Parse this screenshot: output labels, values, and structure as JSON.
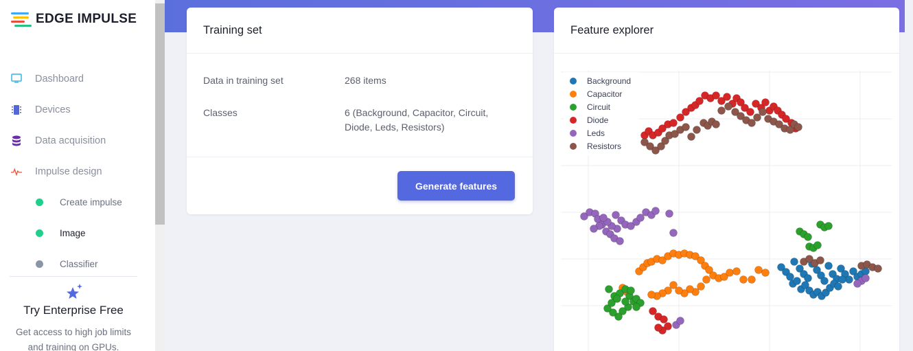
{
  "app": {
    "logo_text": "EDGE IMPULSE"
  },
  "sidebar": {
    "items": [
      {
        "label": "Dashboard",
        "icon": "monitor-icon",
        "color": "#35b7e0"
      },
      {
        "label": "Devices",
        "icon": "chip-icon",
        "color": "#5566d6"
      },
      {
        "label": "Data acquisition",
        "icon": "database-icon",
        "color": "#6a2fa8"
      },
      {
        "label": "Impulse design",
        "icon": "pulse-icon",
        "color": "#e8553d"
      }
    ],
    "subitems": [
      {
        "label": "Create impulse",
        "dot_color": "#1fcf8b"
      },
      {
        "label": "Image",
        "dot_color": "#1fcf8b"
      },
      {
        "label": "Classifier",
        "dot_color": "#8b95a8"
      }
    ],
    "promo": {
      "title": "Try Enterprise Free",
      "text": "Get access to high job limits and training on GPUs."
    }
  },
  "training_set": {
    "title": "Training set",
    "rows": [
      {
        "label": "Data in training set",
        "value": "268 items"
      },
      {
        "label": "Classes",
        "value": "6 (Background, Capacitor, Circuit, Diode, Leds, Resistors)"
      }
    ],
    "button_label": "Generate features"
  },
  "feature_explorer": {
    "title": "Feature explorer",
    "chart_data": {
      "type": "scatter",
      "grid": true,
      "legend_position": "top-left",
      "series": [
        {
          "name": "Background",
          "color": "#1f77b4",
          "points": [
            [
              323,
              378
            ],
            [
              330,
              385
            ],
            [
              336,
              392
            ],
            [
              342,
              370
            ],
            [
              350,
              380
            ],
            [
              356,
              388
            ],
            [
              362,
              394
            ],
            [
              368,
              373
            ],
            [
              375,
              382
            ],
            [
              381,
              390
            ],
            [
              386,
              398
            ],
            [
              392,
              376
            ],
            [
              398,
              388
            ],
            [
              404,
              395
            ],
            [
              410,
              380
            ],
            [
              416,
              388
            ],
            [
              422,
              396
            ],
            [
              428,
              384
            ],
            [
              434,
              392
            ],
            [
              440,
              388
            ],
            [
              446,
              384
            ],
            [
              340,
              402
            ],
            [
              346,
              398
            ],
            [
              352,
              410
            ],
            [
              358,
              404
            ],
            [
              364,
              412
            ],
            [
              370,
              418
            ],
            [
              376,
              414
            ],
            [
              382,
              420
            ],
            [
              388,
              415
            ],
            [
              394,
              408
            ],
            [
              400,
              402
            ],
            [
              406,
              406
            ],
            [
              412,
              396
            ]
          ]
        },
        {
          "name": "Capacitor",
          "color": "#ff7f0e",
          "points": [
            [
              116,
              384
            ],
            [
              122,
              378
            ],
            [
              128,
              372
            ],
            [
              134,
              370
            ],
            [
              142,
              366
            ],
            [
              150,
              368
            ],
            [
              158,
              362
            ],
            [
              166,
              358
            ],
            [
              174,
              360
            ],
            [
              182,
              358
            ],
            [
              190,
              360
            ],
            [
              198,
              362
            ],
            [
              206,
              368
            ],
            [
              212,
              376
            ],
            [
              218,
              382
            ],
            [
              224,
              390
            ],
            [
              232,
              394
            ],
            [
              240,
              392
            ],
            [
              248,
              386
            ],
            [
              258,
              384
            ],
            [
              268,
              396
            ],
            [
              280,
              396
            ],
            [
              290,
              382
            ],
            [
              300,
              386
            ],
            [
              214,
              396
            ],
            [
              206,
              406
            ],
            [
              198,
              414
            ],
            [
              190,
              410
            ],
            [
              182,
              416
            ],
            [
              174,
              412
            ],
            [
              166,
              404
            ],
            [
              158,
              412
            ],
            [
              150,
              416
            ],
            [
              142,
              420
            ],
            [
              134,
              418
            ],
            [
              92,
              408
            ],
            [
              98,
              414
            ]
          ]
        },
        {
          "name": "Circuit",
          "color": "#2ca02c",
          "points": [
            [
              72,
              410
            ],
            [
              80,
              420
            ],
            [
              88,
              416
            ],
            [
              96,
              410
            ],
            [
              102,
              420
            ],
            [
              108,
              428
            ],
            [
              100,
              436
            ],
            [
              92,
              442
            ],
            [
              86,
              450
            ],
            [
              78,
              444
            ],
            [
              70,
              438
            ],
            [
              76,
              430
            ],
            [
              84,
              424
            ],
            [
              96,
              428
            ],
            [
              104,
              412
            ],
            [
              112,
              424
            ],
            [
              118,
              430
            ],
            [
              112,
              436
            ],
            [
              350,
              326
            ],
            [
              356,
              330
            ],
            [
              362,
              334
            ],
            [
              380,
              316
            ],
            [
              386,
              320
            ],
            [
              392,
              318
            ],
            [
              364,
              348
            ],
            [
              370,
              350
            ],
            [
              376,
              346
            ]
          ]
        },
        {
          "name": "Diode",
          "color": "#d62728",
          "points": [
            [
              124,
              186
            ],
            [
              130,
              180
            ],
            [
              136,
              186
            ],
            [
              144,
              182
            ],
            [
              150,
              176
            ],
            [
              158,
              170
            ],
            [
              166,
              168
            ],
            [
              176,
              160
            ],
            [
              184,
              152
            ],
            [
              192,
              146
            ],
            [
              198,
              142
            ],
            [
              204,
              136
            ],
            [
              212,
              128
            ],
            [
              220,
              132
            ],
            [
              228,
              128
            ],
            [
              236,
              136
            ],
            [
              244,
              130
            ],
            [
              252,
              140
            ],
            [
              258,
              132
            ],
            [
              264,
              138
            ],
            [
              270,
              146
            ],
            [
              278,
              152
            ],
            [
              286,
              140
            ],
            [
              294,
              146
            ],
            [
              300,
              138
            ],
            [
              306,
              150
            ],
            [
              312,
              144
            ],
            [
              318,
              150
            ],
            [
              324,
              156
            ],
            [
              330,
              162
            ],
            [
              338,
              168
            ],
            [
              344,
              176
            ],
            [
              136,
              442
            ],
            [
              144,
              450
            ],
            [
              152,
              454
            ],
            [
              158,
              464
            ],
            [
              150,
              470
            ],
            [
              144,
              466
            ]
          ]
        },
        {
          "name": "Leds",
          "color": "#9467bd",
          "points": [
            [
              36,
              304
            ],
            [
              44,
              298
            ],
            [
              52,
              300
            ],
            [
              56,
              308
            ],
            [
              62,
              316
            ],
            [
              68,
              326
            ],
            [
              74,
              330
            ],
            [
              80,
              336
            ],
            [
              88,
              340
            ],
            [
              84,
              322
            ],
            [
              76,
              318
            ],
            [
              70,
              312
            ],
            [
              64,
              306
            ],
            [
              58,
              318
            ],
            [
              50,
              322
            ],
            [
              82,
              302
            ],
            [
              90,
              310
            ],
            [
              96,
              316
            ],
            [
              104,
              318
            ],
            [
              112,
              312
            ],
            [
              118,
              306
            ],
            [
              126,
              298
            ],
            [
              134,
              302
            ],
            [
              140,
              296
            ],
            [
              160,
              300
            ],
            [
              166,
              328
            ],
            [
              170,
              462
            ],
            [
              176,
              456
            ],
            [
              440,
              398
            ],
            [
              446,
              394
            ],
            [
              434,
              402
            ]
          ]
        },
        {
          "name": "Resistors",
          "color": "#8c564b",
          "points": [
            [
              124,
              196
            ],
            [
              132,
              202
            ],
            [
              140,
              208
            ],
            [
              148,
              202
            ],
            [
              154,
              194
            ],
            [
              160,
              186
            ],
            [
              168,
              184
            ],
            [
              176,
              178
            ],
            [
              184,
              174
            ],
            [
              192,
              188
            ],
            [
              200,
              178
            ],
            [
              210,
              168
            ],
            [
              216,
              172
            ],
            [
              222,
              166
            ],
            [
              228,
              170
            ],
            [
              236,
              150
            ],
            [
              246,
              144
            ],
            [
              256,
              152
            ],
            [
              264,
              158
            ],
            [
              272,
              164
            ],
            [
              280,
              168
            ],
            [
              288,
              160
            ],
            [
              296,
              152
            ],
            [
              304,
              162
            ],
            [
              312,
              166
            ],
            [
              320,
              170
            ],
            [
              328,
              176
            ],
            [
              336,
              178
            ],
            [
              342,
              170
            ],
            [
              348,
              174
            ],
            [
              356,
              370
            ],
            [
              364,
              366
            ],
            [
              372,
              372
            ],
            [
              380,
              368
            ],
            [
              440,
              376
            ],
            [
              448,
              374
            ],
            [
              456,
              378
            ],
            [
              464,
              380
            ]
          ]
        }
      ]
    }
  }
}
